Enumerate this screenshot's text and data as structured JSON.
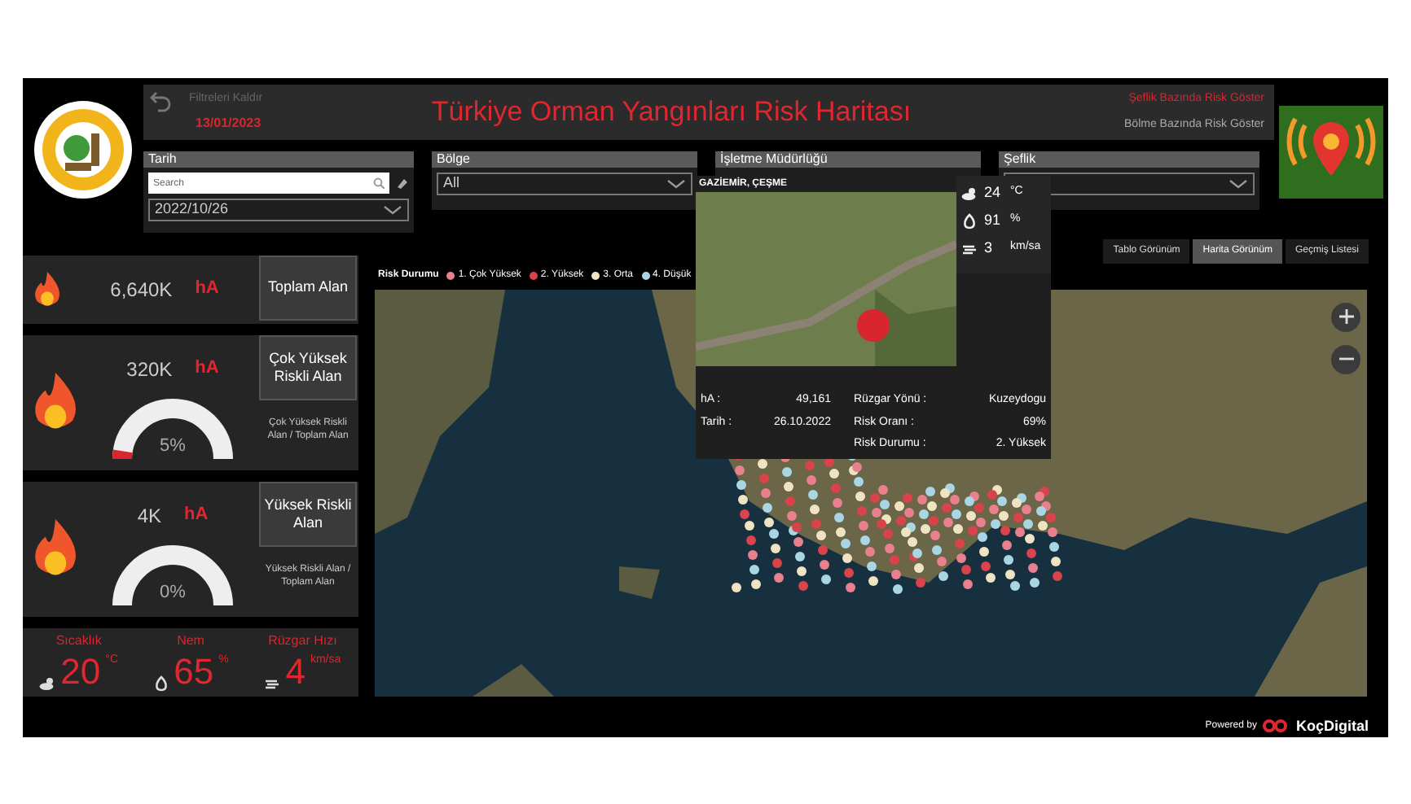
{
  "header": {
    "reset_label": "Filtreleri Kaldır",
    "date": "13/01/2023",
    "title": "Türkiye Orman Yangınları Risk Haritası",
    "view_options": [
      {
        "label": "Şeflik Bazında Risk Göster",
        "selected": true
      },
      {
        "label": "Bölme Bazında Risk Göster",
        "selected": false
      }
    ]
  },
  "filters": [
    {
      "label": "Tarih",
      "kind": "search_dropdown",
      "placeholder": "Search",
      "value": "2022/10/26"
    },
    {
      "label": "Bölge",
      "kind": "dropdown",
      "value": "All"
    },
    {
      "label": "İşletme Müdürlüğü",
      "kind": "covered"
    },
    {
      "label": "Şeflik",
      "kind": "dropdown"
    }
  ],
  "cards": [
    {
      "kind": "plain",
      "value": "6,640K",
      "unit": "hA",
      "button": "Toplam Alan"
    },
    {
      "kind": "gauge",
      "value": "320K",
      "unit": "hA",
      "button": "Çok Yüksek Riskli Alan",
      "level": 0.05,
      "percent": "5%",
      "caption": "Çok Yüksek Riskli Alan / Toplam Alan"
    },
    {
      "kind": "gauge",
      "value": "4K",
      "unit": "hA",
      "button": "Yüksek Riskli Alan",
      "percent": "0%",
      "caption": "Yüksek Riskli Alan / Toplam Alan"
    }
  ],
  "weather": [
    {
      "kind": "temperature",
      "label": "Sıcaklık",
      "value": "20",
      "unit": "°C"
    },
    {
      "kind": "humidity",
      "label": "Nem",
      "value": "65",
      "unit": "%"
    },
    {
      "kind": "wind",
      "label": "Rüzgar Hızı",
      "value": "4",
      "unit": "km/sa"
    }
  ],
  "view_tabs": [
    {
      "label": "Tablo Görünüm",
      "selected": false
    },
    {
      "label": "Harita Görünüm",
      "selected": true
    },
    {
      "label": "Geçmiş Listesi",
      "selected": false
    }
  ],
  "legend": {
    "title": "Risk Durumu",
    "items": [
      {
        "label": "1. Çok Yüksek",
        "color": "#e8808e"
      },
      {
        "label": "2. Yüksek",
        "color": "#d9434b"
      },
      {
        "label": "3. Orta",
        "color": "#efe3c2"
      },
      {
        "label": "4. Düşük",
        "color": "#a9d6e5"
      }
    ]
  },
  "popup": {
    "location": "GAZİEMİR, ÇEŞME",
    "weather": [
      {
        "kind": "temperature",
        "value": "24",
        "unit": "°C"
      },
      {
        "kind": "humidity",
        "value": "91",
        "unit": "%"
      },
      {
        "kind": "wind",
        "value": "3",
        "unit": "km/sa"
      }
    ],
    "details_left": [
      {
        "label": "hA :",
        "value": "49,161"
      },
      {
        "label": "Tarih :",
        "value": "26.10.2022"
      }
    ],
    "details_right": [
      {
        "label": "Rüzgar Yönü :",
        "value": "Kuzeydogu"
      },
      {
        "label": "Risk Oranı :",
        "value": "69%"
      },
      {
        "label": "Risk Durumu :",
        "value": "2. Yüksek"
      }
    ]
  },
  "footer": {
    "powered_by": "Powered by",
    "brand": "KoçDigital"
  }
}
